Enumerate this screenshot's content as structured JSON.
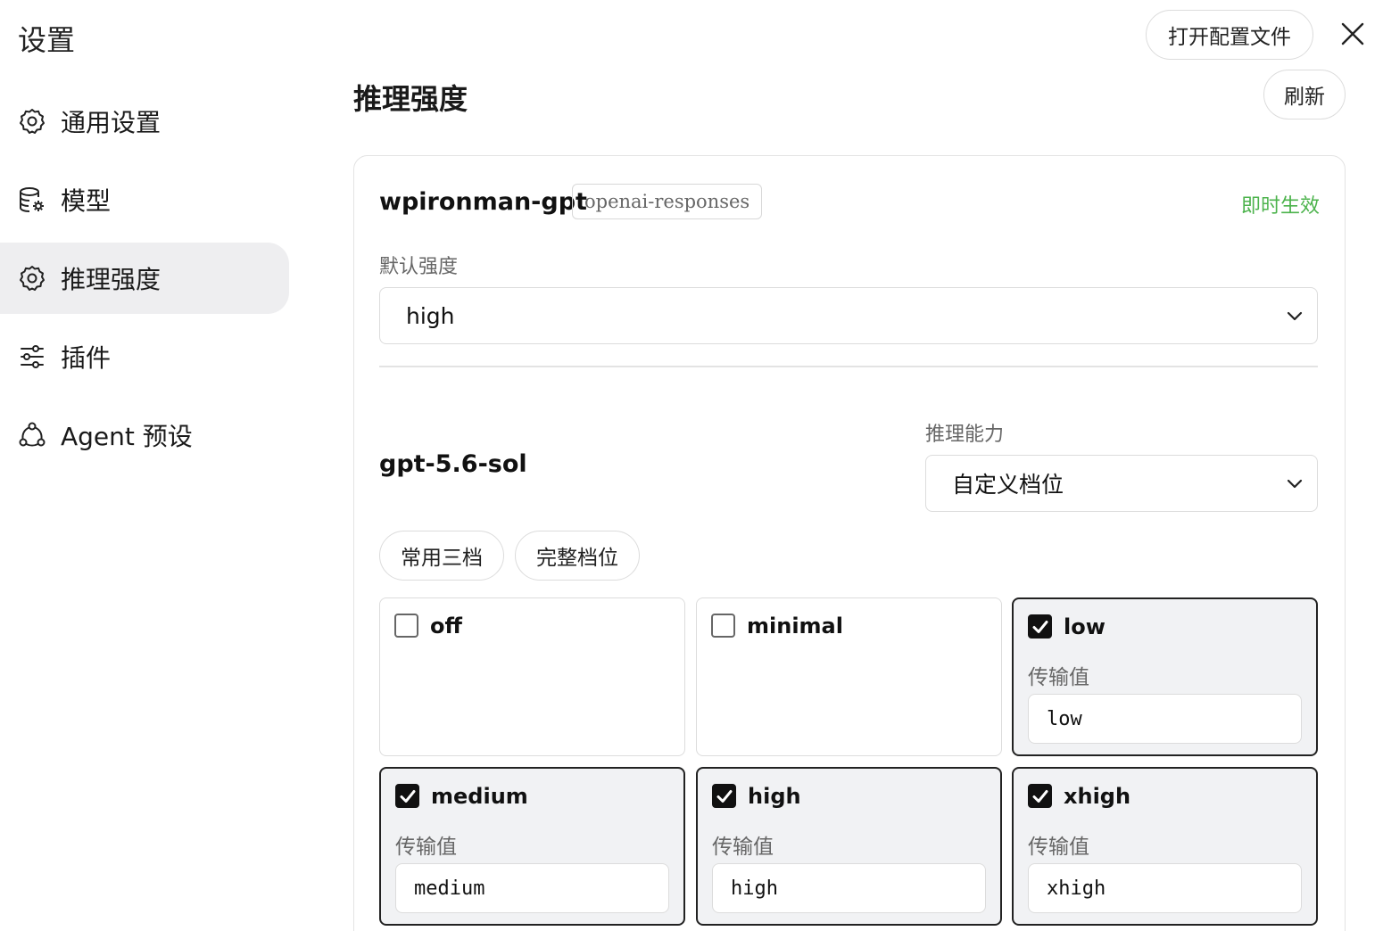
{
  "window": {
    "title": "设置",
    "open_config_label": "打开配置文件"
  },
  "sidebar": {
    "items": [
      {
        "label": "通用设置",
        "icon": "gear-icon",
        "active": false
      },
      {
        "label": "模型",
        "icon": "database-gear-icon",
        "active": false
      },
      {
        "label": "推理强度",
        "icon": "gear-icon",
        "active": true
      },
      {
        "label": "插件",
        "icon": "sliders-icon",
        "active": false
      },
      {
        "label": "Agent 预设",
        "icon": "share-nodes-icon",
        "active": false
      }
    ]
  },
  "main": {
    "title": "推理强度",
    "refresh_label": "刷新",
    "provider": {
      "name": "wpironman-gpt",
      "tag": "openai-responses",
      "status": "即时生效",
      "status_color": "#4cb34c",
      "default_label": "默认强度",
      "default_value": "high"
    },
    "model": {
      "name": "gpt-5.6-sol",
      "capability_label": "推理能力",
      "capability_value": "自定义档位",
      "presets": [
        "常用三档",
        "完整档位"
      ],
      "value_label": "传输值",
      "levels": [
        {
          "name": "off",
          "checked": false,
          "value": ""
        },
        {
          "name": "minimal",
          "checked": false,
          "value": ""
        },
        {
          "name": "low",
          "checked": true,
          "value": "low"
        },
        {
          "name": "medium",
          "checked": true,
          "value": "medium"
        },
        {
          "name": "high",
          "checked": true,
          "value": "high"
        },
        {
          "name": "xhigh",
          "checked": true,
          "value": "xhigh"
        }
      ]
    }
  }
}
